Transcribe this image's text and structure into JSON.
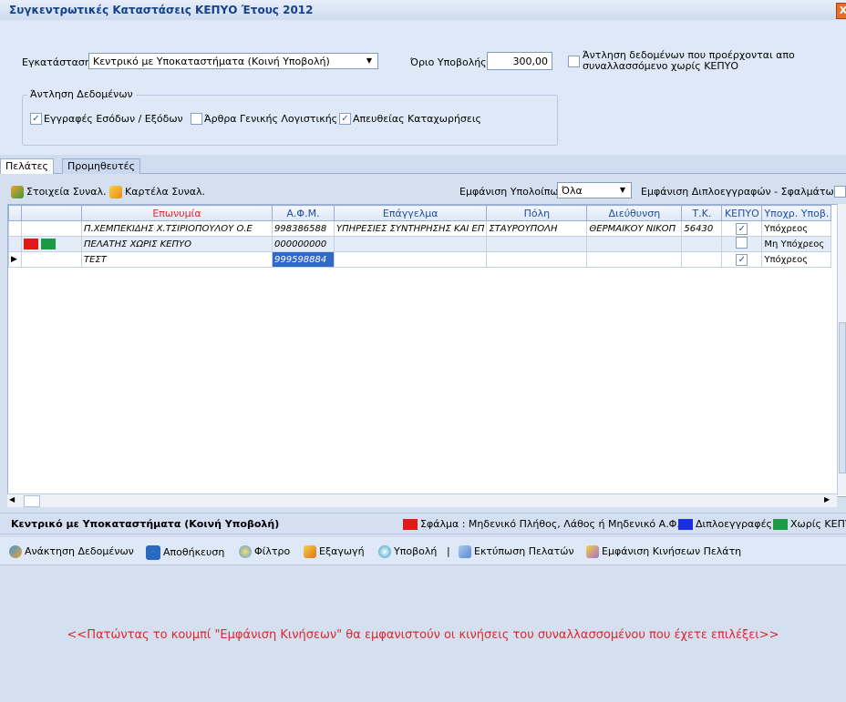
{
  "window": {
    "title": "Συγκεντρωτικές Καταστάσεις ΚΕΠΥΟ Έτους 2012",
    "close_glyph": "X"
  },
  "filters": {
    "installation_label": "Εγκατάσταση",
    "installation_value": "Κεντρικό με Υποκαταστήματα (Κοινή Υποβολή)",
    "limit_label": "Όριο Υποβολής",
    "limit_value": "300,00",
    "no_kepyo_line1": "Άντληση δεδομένων που προέρχονται απο",
    "no_kepyo_line2": "συναλλασσόμενο χωρίς ΚΕΠΥΟ",
    "no_kepyo_checked": false,
    "group_title": "Άντληση Δεδομένων",
    "options": [
      {
        "label": "Εγγραφές Εσόδων / Εξόδων",
        "checked": true
      },
      {
        "label": "Άρθρα Γενικής Λογιστικής",
        "checked": false
      },
      {
        "label": "Απευθείας Καταχωρήσεις",
        "checked": true
      }
    ]
  },
  "tabs": [
    {
      "label": "Πελάτες"
    },
    {
      "label": "Προμηθευτές"
    }
  ],
  "toolbar": {
    "partner_details": "Στοιχεία Συναλ.",
    "partner_card": "Καρτέλα Συναλ.",
    "balance_label": "Εμφάνιση Υπολοίπων",
    "balance_value": "Όλα",
    "duplicates_label": "Εμφάνιση Διπλοεγγραφών - Σφαλμάτων"
  },
  "grid": {
    "columns": [
      "",
      "Επωνυμία",
      "Α.Φ.Μ.",
      "Επάγγελμα",
      "Πόλη",
      "Διεύθυνση",
      "Τ.Κ.",
      "ΚΕΠΥΟ",
      "Υποχρ. Υποβ."
    ],
    "rows": [
      {
        "name": "Π.ΧΕΜΠΕΚΙΔΗΣ Χ.ΤΣΙΡΙΟΠΟΥΛΟΥ Ο.Ε",
        "afm": "998386588",
        "profession": "ΥΠΗΡΕΣΙΕΣ ΣΥΝΤΗΡΗΣΗΣ ΚΑΙ ΕΠ",
        "city": "ΣΤΑΥΡΟΥΠΟΛΗ",
        "address": "ΘΕΡΜΑΙΚΟΥ ΝΙΚΟΠ",
        "tk": "56430",
        "kepyo": true,
        "obligation": "Υπόχρεος"
      },
      {
        "name": "ΠΕΛΑΤΗΣ ΧΩΡΙΣ ΚΕΠΥΟ",
        "afm": "000000000",
        "profession": "",
        "city": "",
        "address": "",
        "tk": "",
        "kepyo": false,
        "obligation": "Μη Υπόχρεος"
      },
      {
        "name": "ΤΕΣΤ",
        "afm": "999598884",
        "profession": "",
        "city": "",
        "address": "",
        "tk": "",
        "kepyo": true,
        "obligation": "Υπόχρεος"
      }
    ]
  },
  "status": {
    "installation": "Κεντρικό με Υποκαταστήματα (Κοινή Υποβολή)",
    "legend": [
      {
        "color": "#e01818",
        "label": "Σφάλμα : Μηδενικό Πλήθος, Λάθος ή Μηδενικό Α.Φ.Μ."
      },
      {
        "color": "#1a2ee0",
        "label": "Διπλοεγγραφές"
      },
      {
        "color": "#1a9a44",
        "label": "Χωρίς ΚΕΠΥΟ"
      }
    ]
  },
  "actions": {
    "fetch": "Ανάκτηση Δεδομένων",
    "save": "Αποθήκευση",
    "filter": "Φίλτρο",
    "export": "Εξαγωγή",
    "submit": "Υποβολή",
    "separator": "|",
    "print": "Εκτύπωση Πελατών",
    "show_moves": "Εμφάνιση Κινήσεων Πελάτη"
  },
  "hint": "<<Πατώντας το κουμπί \"Εμφάνιση Κινήσεων\" θα εμφανιστούν οι κινήσεις του συναλλασσομένου που έχετε επιλέξει>>",
  "colors": {
    "error": "#e01818",
    "duplicate": "#1a2ee0",
    "no_kepyo": "#1a9a44",
    "hint": "#e0262a"
  }
}
